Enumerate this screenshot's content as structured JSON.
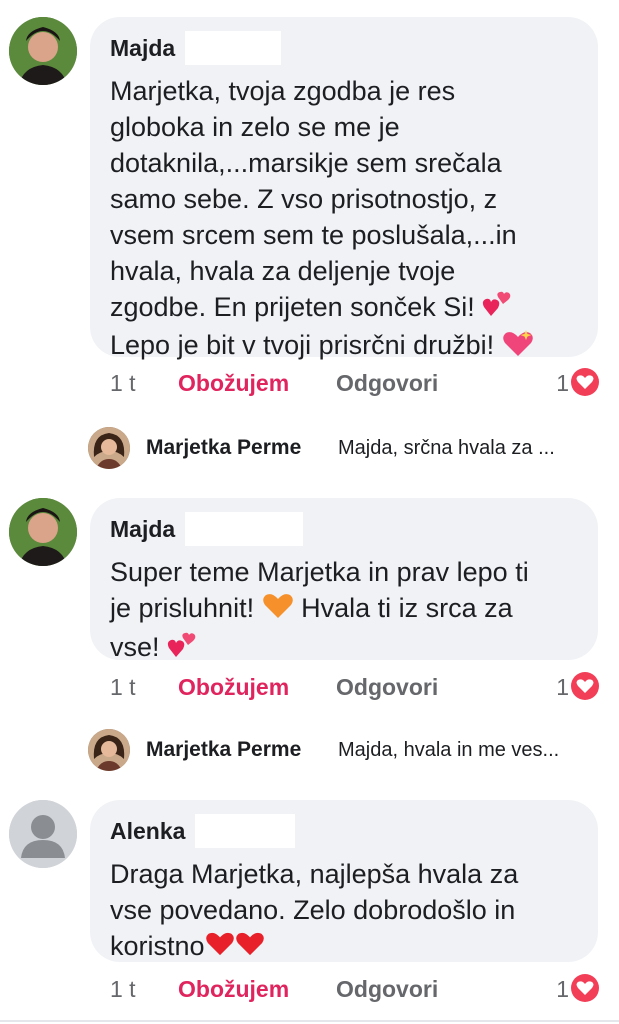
{
  "comments": [
    {
      "author": "Majda",
      "lines": [
        "Marjetka, tvoja zgodba je res",
        "globoka in zelo se me je",
        "dotaknila,...marsikje sem srečala",
        "samo sebe. Z vso prisotnostjo, z",
        "vsem srcem sem te poslušala,...in",
        "hvala, hvala za deljenje tvoje",
        "zgodbe. En prijeten sonček Si!",
        "Lepo je bit v tvoji prisrčni družbi!"
      ],
      "time": "1 t",
      "love": "Obožujem",
      "reply": "Odgovori",
      "reaction_count": "1"
    },
    {
      "author": "Majda",
      "lines": [
        "Super teme Marjetka in prav lepo ti",
        "je prisluhnit!",
        "Hvala ti iz srca za",
        "vse!"
      ],
      "time": "1 t",
      "love": "Obožujem",
      "reply": "Odgovori",
      "reaction_count": "1"
    },
    {
      "author": "Alenka",
      "lines": [
        "Draga Marjetka, najlepša hvala za",
        "vse povedano. Zelo dobrodošlo in",
        "koristno"
      ],
      "time": "1 t",
      "love": "Obožujem",
      "reply": "Odgovori",
      "reaction_count": "1"
    }
  ],
  "replies": [
    {
      "author": "Marjetka Perme",
      "preview": "Majda, srčna hvala za ..."
    },
    {
      "author": "Marjetka Perme",
      "preview": "Majda, hvala in me ves..."
    }
  ],
  "colors": {
    "love_red": "#e0245e",
    "bubble_bg": "#f0f2f5",
    "heart_badge": "#f33e58"
  }
}
